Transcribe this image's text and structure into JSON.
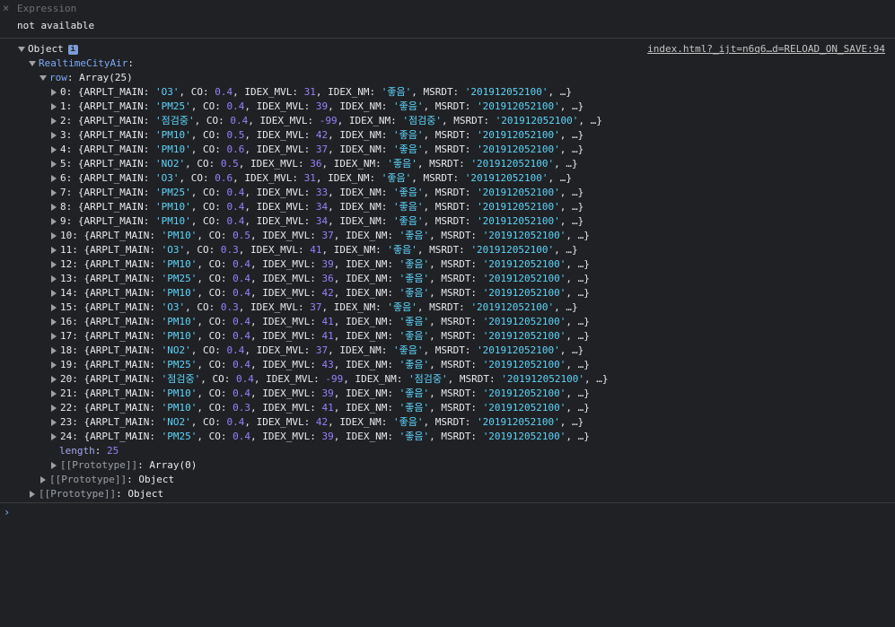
{
  "watch": {
    "close_glyph": "×",
    "placeholder": "Expression",
    "result": "not available"
  },
  "console": {
    "source_link": "index.html?_ijt=n6q6…d=RELOAD_ON_SAVE:94",
    "object_label": "Object",
    "info_glyph": "i",
    "realtime_key": "RealtimeCityAir",
    "row_key": "row",
    "row_type": "Array(25)",
    "rows": [
      {
        "i": "0",
        "main": "'O3'",
        "co": "0.4",
        "mvl": "31",
        "nm": "'좋음'",
        "msrdt": "'201912052100'"
      },
      {
        "i": "1",
        "main": "'PM25'",
        "co": "0.4",
        "mvl": "39",
        "nm": "'좋음'",
        "msrdt": "'201912052100'"
      },
      {
        "i": "2",
        "main": "'점검중'",
        "co": "0.4",
        "mvl": "-99",
        "nm": "'점검중'",
        "msrdt": "'201912052100'"
      },
      {
        "i": "3",
        "main": "'PM10'",
        "co": "0.5",
        "mvl": "42",
        "nm": "'좋음'",
        "msrdt": "'201912052100'"
      },
      {
        "i": "4",
        "main": "'PM10'",
        "co": "0.6",
        "mvl": "37",
        "nm": "'좋음'",
        "msrdt": "'201912052100'"
      },
      {
        "i": "5",
        "main": "'NO2'",
        "co": "0.5",
        "mvl": "36",
        "nm": "'좋음'",
        "msrdt": "'201912052100'"
      },
      {
        "i": "6",
        "main": "'O3'",
        "co": "0.6",
        "mvl": "31",
        "nm": "'좋음'",
        "msrdt": "'201912052100'"
      },
      {
        "i": "7",
        "main": "'PM25'",
        "co": "0.4",
        "mvl": "33",
        "nm": "'좋음'",
        "msrdt": "'201912052100'"
      },
      {
        "i": "8",
        "main": "'PM10'",
        "co": "0.4",
        "mvl": "34",
        "nm": "'좋음'",
        "msrdt": "'201912052100'"
      },
      {
        "i": "9",
        "main": "'PM10'",
        "co": "0.4",
        "mvl": "34",
        "nm": "'좋음'",
        "msrdt": "'201912052100'"
      },
      {
        "i": "10",
        "main": "'PM10'",
        "co": "0.5",
        "mvl": "37",
        "nm": "'좋음'",
        "msrdt": "'201912052100'"
      },
      {
        "i": "11",
        "main": "'O3'",
        "co": "0.3",
        "mvl": "41",
        "nm": "'좋음'",
        "msrdt": "'201912052100'"
      },
      {
        "i": "12",
        "main": "'PM10'",
        "co": "0.4",
        "mvl": "39",
        "nm": "'좋음'",
        "msrdt": "'201912052100'"
      },
      {
        "i": "13",
        "main": "'PM25'",
        "co": "0.4",
        "mvl": "36",
        "nm": "'좋음'",
        "msrdt": "'201912052100'"
      },
      {
        "i": "14",
        "main": "'PM10'",
        "co": "0.4",
        "mvl": "42",
        "nm": "'좋음'",
        "msrdt": "'201912052100'"
      },
      {
        "i": "15",
        "main": "'O3'",
        "co": "0.3",
        "mvl": "37",
        "nm": "'좋음'",
        "msrdt": "'201912052100'"
      },
      {
        "i": "16",
        "main": "'PM10'",
        "co": "0.4",
        "mvl": "41",
        "nm": "'좋음'",
        "msrdt": "'201912052100'"
      },
      {
        "i": "17",
        "main": "'PM10'",
        "co": "0.4",
        "mvl": "41",
        "nm": "'좋음'",
        "msrdt": "'201912052100'"
      },
      {
        "i": "18",
        "main": "'NO2'",
        "co": "0.4",
        "mvl": "37",
        "nm": "'좋음'",
        "msrdt": "'201912052100'"
      },
      {
        "i": "19",
        "main": "'PM25'",
        "co": "0.4",
        "mvl": "43",
        "nm": "'좋음'",
        "msrdt": "'201912052100'"
      },
      {
        "i": "20",
        "main": "'점검중'",
        "co": "0.4",
        "mvl": "-99",
        "nm": "'점검중'",
        "msrdt": "'201912052100'"
      },
      {
        "i": "21",
        "main": "'PM10'",
        "co": "0.4",
        "mvl": "39",
        "nm": "'좋음'",
        "msrdt": "'201912052100'"
      },
      {
        "i": "22",
        "main": "'PM10'",
        "co": "0.3",
        "mvl": "41",
        "nm": "'좋음'",
        "msrdt": "'201912052100'"
      },
      {
        "i": "23",
        "main": "'NO2'",
        "co": "0.4",
        "mvl": "42",
        "nm": "'좋음'",
        "msrdt": "'201912052100'"
      },
      {
        "i": "24",
        "main": "'PM25'",
        "co": "0.4",
        "mvl": "39",
        "nm": "'좋음'",
        "msrdt": "'201912052100'"
      }
    ],
    "length_key": "length",
    "length_value": "25",
    "proto_key": "[[Prototype]]",
    "proto_array": "Array(0)",
    "proto_object": "Object",
    "prompt_glyph": "›"
  },
  "colors": {
    "background": "#202124",
    "string": "#5cd5fb",
    "number": "#9980ff",
    "key": "#7cacf8"
  }
}
